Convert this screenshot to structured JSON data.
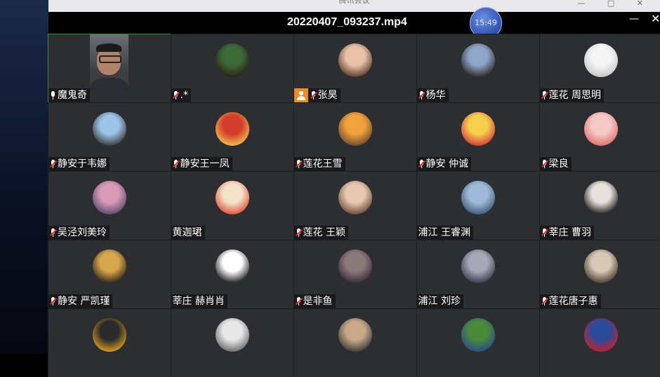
{
  "window": {
    "title": "腾讯会议",
    "controls": [
      "—",
      "□",
      "✕"
    ]
  },
  "player": {
    "file_name": "20220407_093237.mp4",
    "clock": "15:49",
    "minimize": "—",
    "close": "✕"
  },
  "colors": {
    "background": "#202225",
    "tile": "#2c2e32",
    "host_badge": "#f08a24",
    "mute_slash": "#e03131"
  },
  "participants": [
    {
      "name": "魔鬼奇",
      "mic": "on",
      "video": true
    },
    {
      "name": ".*",
      "mic": "muted",
      "avatar": [
        "#3c6b3a",
        "#2a1f14"
      ]
    },
    {
      "name": "张昊",
      "mic": "muted",
      "host": true,
      "avatar": [
        "#e9c2a8",
        "#5a3a2a"
      ]
    },
    {
      "name": "杨华",
      "mic": "muted",
      "avatar": [
        "#8fa6c8",
        "#2b2b2b"
      ]
    },
    {
      "name": "莲花 周思明",
      "mic": "muted",
      "avatar": [
        "#f4f4f4",
        "#c9c9c9"
      ]
    },
    {
      "name": "静安于韦娜",
      "mic": "muted",
      "avatar": [
        "#9cc3e8",
        "#3a3a3a"
      ]
    },
    {
      "name": "静安王一凤",
      "mic": "muted",
      "avatar": [
        "#d43c2c",
        "#f2c14e"
      ]
    },
    {
      "name": "莲花王雪",
      "mic": "muted",
      "avatar": [
        "#f2a23c",
        "#6b4a2f"
      ]
    },
    {
      "name": "静安 仲诚",
      "mic": "muted",
      "avatar": [
        "#f6d04d",
        "#d23a3a"
      ]
    },
    {
      "name": "梁良",
      "mic": "muted",
      "avatar": [
        "#f4c9c6",
        "#e46e6e"
      ]
    },
    {
      "name": "吴泾刘美玲",
      "mic": "muted",
      "avatar": [
        "#d99ab8",
        "#5a4a6a"
      ]
    },
    {
      "name": "黄迦珺",
      "mic": "none",
      "avatar": [
        "#f3e3c8",
        "#e0513a"
      ]
    },
    {
      "name": "莲花 王颖",
      "mic": "muted",
      "avatar": [
        "#e8c9b0",
        "#6a4a3a"
      ]
    },
    {
      "name": "浦江 王睿渊",
      "mic": "none",
      "avatar": [
        "#9fb9d8",
        "#3e5a7a"
      ]
    },
    {
      "name": "莘庄 曹羽",
      "mic": "muted",
      "avatar": [
        "#e6e1dc",
        "#1a1a1a"
      ]
    },
    {
      "name": "静安 严凯瑾",
      "mic": "muted",
      "avatar": [
        "#d9a74e",
        "#2a2418"
      ]
    },
    {
      "name": "莘庄 赫肖肖",
      "mic": "none",
      "avatar": [
        "#ffffff",
        "#1b1b1b"
      ]
    },
    {
      "name": "是非鱼",
      "mic": "muted",
      "avatar": [
        "#8a7a7a",
        "#3a2a3a"
      ]
    },
    {
      "name": "浦江 刘珍",
      "mic": "none",
      "avatar": [
        "#a8a8b8",
        "#3a3a4a"
      ]
    },
    {
      "name": "莲花唐子惠",
      "mic": "muted",
      "avatar": [
        "#d8c8b8",
        "#4a3a2a"
      ]
    },
    {
      "name": "",
      "mic": "none",
      "avatar": [
        "#2a2a2a",
        "#e0a020"
      ]
    },
    {
      "name": "",
      "mic": "none",
      "avatar": [
        "#e8e8e8",
        "#6a6a6a"
      ]
    },
    {
      "name": "",
      "mic": "none",
      "avatar": [
        "#c8a888",
        "#3a3a3a"
      ]
    },
    {
      "name": "",
      "mic": "none",
      "avatar": [
        "#4a8a3a",
        "#2a4a8a"
      ]
    },
    {
      "name": "",
      "mic": "none",
      "avatar": [
        "#2a4a9a",
        "#c8202a"
      ]
    }
  ]
}
